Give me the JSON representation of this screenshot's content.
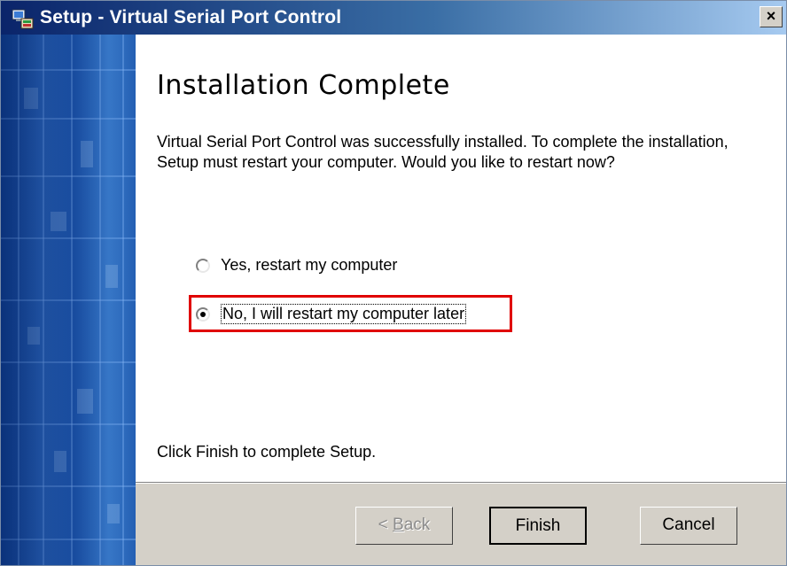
{
  "window": {
    "title": "Setup - Virtual Serial Port Control",
    "close_glyph": "×"
  },
  "icons": {
    "app": "installer-computer-icon",
    "close": "close-icon"
  },
  "page": {
    "heading": "Installation Complete",
    "description": "Virtual Serial Port Control was successfully installed. To complete the installation, Setup must restart your computer. Would you like to restart now?",
    "options": [
      {
        "label": "Yes, restart my computer",
        "selected": false
      },
      {
        "label": "No, I will restart my computer later",
        "selected": true
      }
    ],
    "footer_note": "Click Finish to complete Setup."
  },
  "buttons": {
    "back_prefix": "< ",
    "back_accel": "B",
    "back_rest": "ack",
    "finish": "Finish",
    "cancel": "Cancel"
  },
  "colors": {
    "title_gradient_start": "#0a246a",
    "title_gradient_end": "#a6caf0",
    "highlight": "#e00000",
    "side_panel": "#1d56ad"
  }
}
